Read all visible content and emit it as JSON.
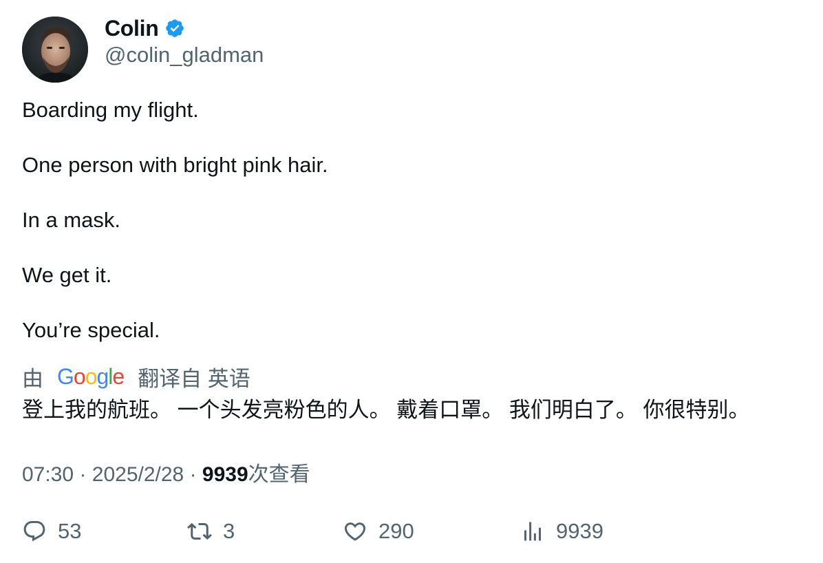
{
  "author": {
    "display_name": "Colin",
    "handle": "@colin_gladman",
    "verified": true
  },
  "tweet": {
    "paragraphs": [
      "Boarding my flight.",
      "One person with bright pink hair.",
      "In a mask.",
      "We get it.",
      "You’re special."
    ]
  },
  "translation": {
    "prefix": "由",
    "provider_logo_text": "Google",
    "suffix": "翻译自 英语",
    "text": "登上我的航班。 一个头发亮粉色的人。 戴着口罩。 我们明白了。 你很特别。"
  },
  "meta": {
    "time": "07:30",
    "separator": "·",
    "date": "2025/2/28",
    "views_count": "9939",
    "views_label": "次查看"
  },
  "actions": {
    "replies": "53",
    "reposts": "3",
    "likes": "290",
    "views": "9939"
  },
  "colors": {
    "text_primary": "#0f1419",
    "text_secondary": "#536471",
    "verified_blue": "#1d9bf0",
    "google_blue": "#4285F4",
    "google_red": "#EA4335",
    "google_yellow": "#FBBC05",
    "google_green": "#34A853"
  },
  "icons": {
    "reply": "speech-bubble-icon",
    "repost": "repost-arrows-icon",
    "like": "heart-icon",
    "views": "bar-chart-icon",
    "verified": "verified-badge-icon"
  }
}
